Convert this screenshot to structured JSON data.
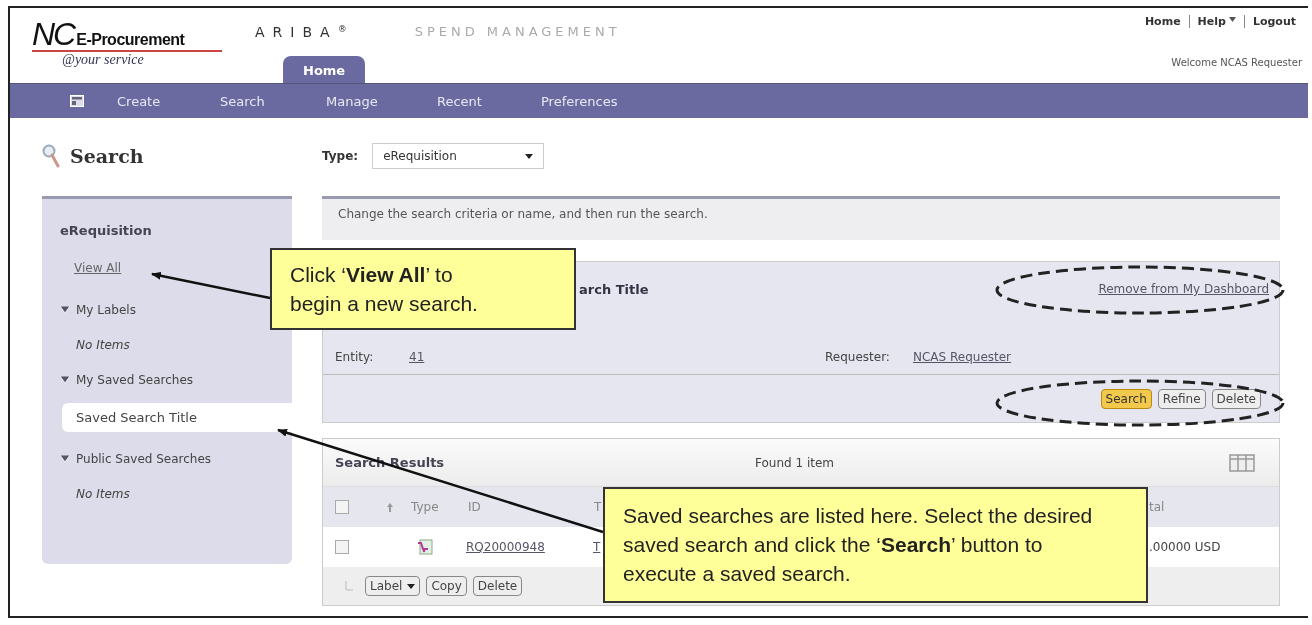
{
  "header": {
    "logo": {
      "mark": "NC",
      "name": "E-Procurement",
      "tagline": "@your service"
    },
    "brand": "ARIBA",
    "brand_mark": "®",
    "product": "SPEND MANAGEMENT",
    "tabs": [
      {
        "label": "Home",
        "selected": true
      }
    ],
    "top_links": [
      {
        "label": "Home",
        "menu": false
      },
      {
        "label": "Help",
        "menu": true
      },
      {
        "label": "Logout",
        "menu": false
      }
    ],
    "welcome": "Welcome NCAS Requester"
  },
  "nav": {
    "items": [
      "Create",
      "Search",
      "Manage",
      "Recent",
      "Preferences"
    ]
  },
  "page_title": "Search",
  "type_field": {
    "label": "Type:",
    "value": "eRequisition"
  },
  "sidebar": {
    "heading": "eRequisition",
    "items": [
      {
        "kind": "link",
        "label": "View All"
      },
      {
        "kind": "section",
        "label": "My Labels",
        "expanded": true,
        "children": [
          {
            "kind": "empty",
            "label": "No Items"
          }
        ]
      },
      {
        "kind": "section",
        "label": "My Saved Searches",
        "expanded": true,
        "children": [
          {
            "kind": "item",
            "label": "Saved Search Title",
            "selected": true
          }
        ]
      },
      {
        "kind": "section",
        "label": "Public Saved Searches",
        "expanded": true,
        "children": [
          {
            "kind": "empty",
            "label": "No Items"
          }
        ]
      }
    ]
  },
  "instruction": "Change the search criteria or name, and then run the search.",
  "saved_search": {
    "title": "arch Title",
    "link": "Remove from My Dashboard",
    "fields": [
      {
        "label": "Entity:",
        "value": "41"
      },
      {
        "label": "Requester:",
        "value": "NCAS Requester"
      }
    ],
    "buttons": [
      {
        "label": "Search",
        "kind": "primary"
      },
      {
        "label": "Refine",
        "kind": "secondary"
      },
      {
        "label": "Delete",
        "kind": "secondary"
      }
    ]
  },
  "results": {
    "title": "Search Results",
    "count": "Found 1 item",
    "all_checked": false,
    "columns": [
      "Type",
      "ID",
      "T",
      "tal"
    ],
    "rows": [
      {
        "checked": false,
        "id": "RQ20000948",
        "title": "T",
        "total": ".00000 USD"
      }
    ],
    "actions": [
      {
        "label": "Label",
        "kind": "menu"
      },
      {
        "label": "Copy",
        "kind": "plain"
      },
      {
        "label": "Delete",
        "kind": "plain"
      }
    ]
  },
  "callouts": [
    {
      "text": "Click ‘**View All**’ to begin a new search."
    },
    {
      "text": "Saved searches are listed here. Select the desired saved search and click the ‘**Search**’ button to execute a saved search."
    }
  ]
}
